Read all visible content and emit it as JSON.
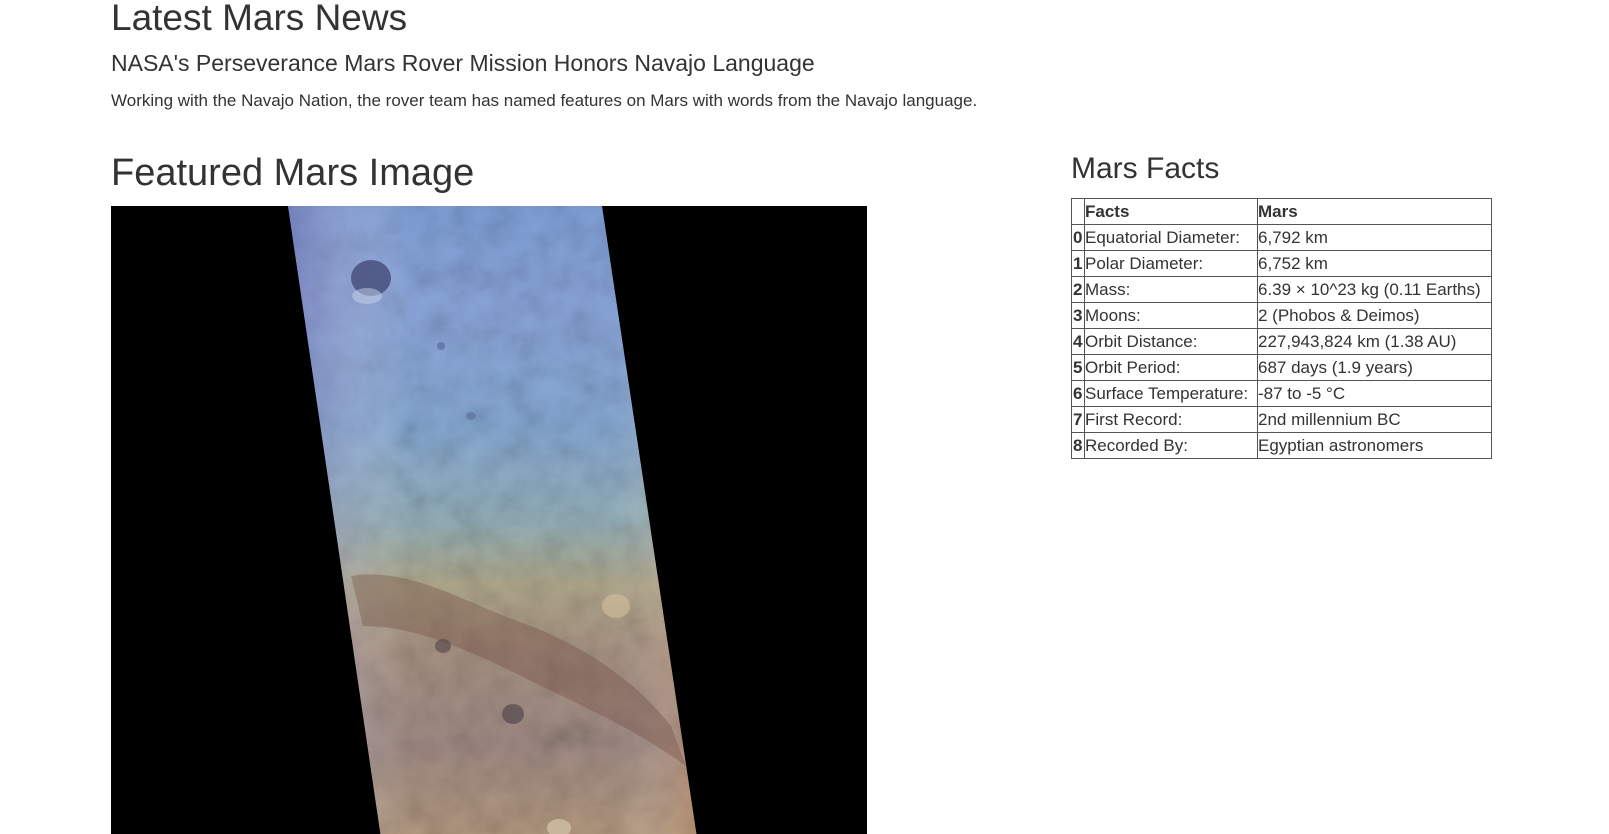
{
  "news": {
    "heading": "Latest Mars News",
    "title": "NASA's Perseverance Mars Rover Mission Honors Navajo Language",
    "teaser": "Working with the Navajo Nation, the rover team has named features on Mars with words from the Navajo language."
  },
  "featured": {
    "heading": "Featured Mars Image",
    "image_alt": "Featured Mars Image"
  },
  "facts": {
    "heading": "Mars Facts",
    "columns": [
      "",
      "Facts",
      "Mars"
    ],
    "rows": [
      {
        "index": "0",
        "label": "Equatorial Diameter:",
        "value": "6,792 km"
      },
      {
        "index": "1",
        "label": "Polar Diameter:",
        "value": "6,752 km"
      },
      {
        "index": "2",
        "label": "Mass:",
        "value": "6.39 × 10^23 kg (0.11 Earths)"
      },
      {
        "index": "3",
        "label": "Moons:",
        "value": "2 (Phobos & Deimos)"
      },
      {
        "index": "4",
        "label": "Orbit Distance:",
        "value": "227,943,824 km (1.38 AU)"
      },
      {
        "index": "5",
        "label": "Orbit Period:",
        "value": "687 days (1.9 years)"
      },
      {
        "index": "6",
        "label": "Surface Temperature:",
        "value": "-87 to -5 °C"
      },
      {
        "index": "7",
        "label": "First Record:",
        "value": "2nd millennium BC"
      },
      {
        "index": "8",
        "label": "Recorded By:",
        "value": "Egyptian astronomers"
      }
    ]
  },
  "colors": {
    "text": "#333333",
    "image_background": "#000000"
  }
}
